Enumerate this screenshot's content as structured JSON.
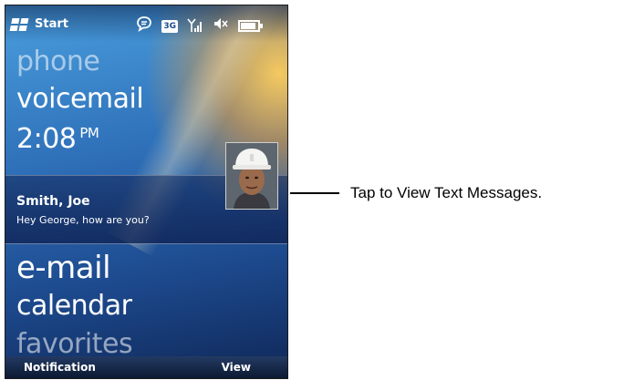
{
  "status_bar": {
    "start_label": "Start",
    "icons": [
      "chat-bubble-icon",
      "3g-icon",
      "signal-icon",
      "speaker-mute-icon",
      "battery-icon"
    ],
    "network_badge": "3G"
  },
  "menu": {
    "items": [
      {
        "label": "phone"
      },
      {
        "label": "voicemail"
      },
      {
        "label": "e-mail"
      },
      {
        "label": "calendar"
      },
      {
        "label": "favorites"
      }
    ],
    "time": "2:08",
    "ampm": "PM"
  },
  "notification": {
    "sender": "Smith, Joe",
    "message": "Hey George, how are you?",
    "avatar_icon": "contact-photo-icon"
  },
  "softkeys": {
    "left": "Notification",
    "right": "View"
  },
  "callout": {
    "text": "Tap to View Text Messages."
  }
}
